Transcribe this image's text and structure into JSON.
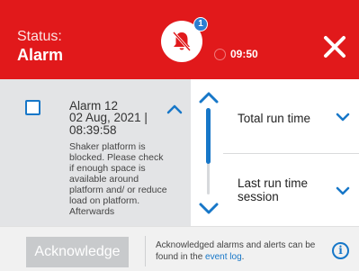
{
  "header": {
    "status_label": "Status:",
    "status_value": "Alarm",
    "notification_count": "1",
    "time": "09:50",
    "accent_color": "#e1191b",
    "icons": {
      "center": "alarm-muted-bell-icon",
      "close": "close-icon",
      "time": "clock-icon"
    }
  },
  "alarm": {
    "title": "Alarm 12",
    "datetime": "02 Aug, 2021 | 08:39:58",
    "description": "Shaker platform is blocked. Please check if enough space is available around platform and/ or reduce load on platform. Afterwards",
    "checked": false
  },
  "info_rows": [
    {
      "label": "Total run time"
    },
    {
      "label": "Last run time session"
    }
  ],
  "scroll": {
    "position_fraction": 0.0,
    "visible_fraction": 0.65
  },
  "footer": {
    "acknowledge_label": "Acknowledge",
    "note_text": "Acknowledged alarms and alerts can be found in the ",
    "note_link": "event log",
    "note_end": "."
  },
  "colors": {
    "primary_blue": "#1777c8",
    "panel_gray": "#e3e4e6",
    "disabled_button": "#c8cacc"
  }
}
